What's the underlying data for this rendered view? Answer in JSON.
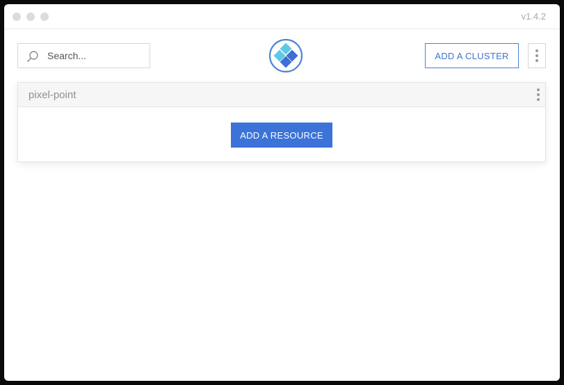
{
  "window": {
    "version": "v1.4.2"
  },
  "toolbar": {
    "search_placeholder": "Search...",
    "add_cluster_label": "ADD A CLUSTER",
    "icons": {
      "search": "search-icon",
      "logo": "app-logo-icon",
      "menu": "more-vertical-icon"
    }
  },
  "clusters": [
    {
      "name": "pixel-point",
      "add_resource_label": "ADD A RESOURCE"
    }
  ],
  "colors": {
    "accent": "#3b73d9",
    "outline_button": "#3f74cc",
    "logo_ring": "#4a86d8",
    "logo_light": "#5fc8e6",
    "logo_dark": "#3d6fd6"
  }
}
